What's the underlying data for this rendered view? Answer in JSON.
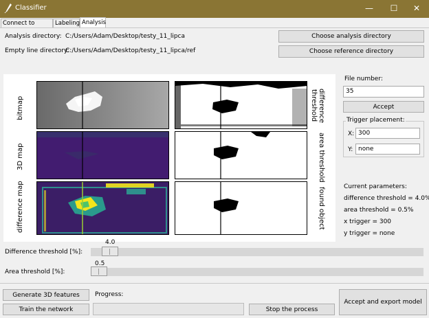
{
  "window": {
    "title": "Classifier",
    "minimize": "—",
    "maximize": "☐",
    "close": "✕"
  },
  "tabs": [
    "Connect to server",
    "Labeling",
    "Analysis"
  ],
  "directories": {
    "analysis_label": "Analysis directory:",
    "analysis_path": "C:/Users/Adam/Desktop/testy_11_lipca",
    "reference_label": "Empty line directory:",
    "reference_path": "C:/Users/Adam/Desktop/testy_11_lipca/ref",
    "choose_analysis": "Choose analysis directory",
    "choose_reference": "Choose reference directory"
  },
  "plot_labels": {
    "bitmap": "bitmap",
    "map3d": "3D map",
    "difference_map": "difference map",
    "difference_threshold": "difference threshold",
    "area_threshold": "area threshold",
    "found_object": "found object"
  },
  "file": {
    "label": "File number:",
    "value": "35",
    "accept": "Accept"
  },
  "trigger": {
    "label": "Trigger placement:",
    "x_label": "X:",
    "x_value": "300",
    "y_label": "Y:",
    "y_value": "none"
  },
  "params": {
    "title": "Current parameters:",
    "diff": "difference threshold = 4.0%",
    "area": "area threshold = 0.5%",
    "x": "x trigger = 300",
    "y": "y trigger = none"
  },
  "sliders": {
    "difference_label": "Difference threshold [%]:",
    "difference_value": "4.0",
    "area_label": "Area threshold [%]:",
    "area_value": "0.5"
  },
  "actions": {
    "generate": "Generate 3D features",
    "train": "Train the network",
    "progress_label": "Progress:",
    "progress": 0,
    "stop": "Stop the process",
    "export": "Accept and export model"
  },
  "colors": {
    "titlebar": "#8a7534",
    "viridis_dark": "#3b1e66",
    "viridis_yellow": "#f3e51c"
  }
}
